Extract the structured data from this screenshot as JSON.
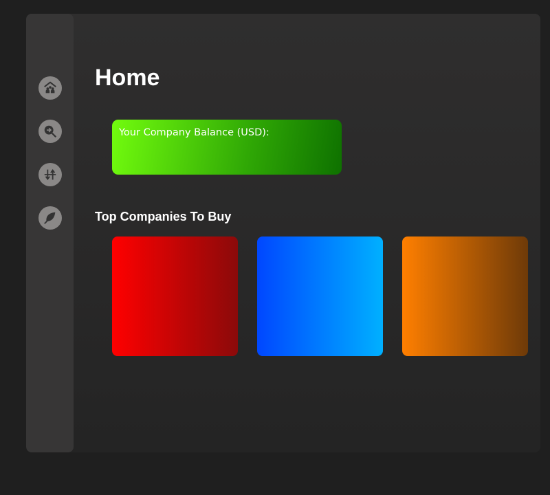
{
  "sidebar": {
    "items": [
      {
        "icon": "community-home-icon"
      },
      {
        "icon": "search-arrow-icon"
      },
      {
        "icon": "swap-vertical-icon"
      },
      {
        "icon": "leaf-icon"
      }
    ]
  },
  "main": {
    "title": "Home",
    "balance_label": "Your Company Balance (USD):",
    "section_title": "Top Companies To Buy",
    "cards": [
      {
        "colors": [
          "#ff0000",
          "#8b0a0a"
        ]
      },
      {
        "colors": [
          "#0047ff",
          "#00b0ff"
        ]
      },
      {
        "colors": [
          "#ff7f00",
          "#6e3a08"
        ]
      }
    ]
  }
}
